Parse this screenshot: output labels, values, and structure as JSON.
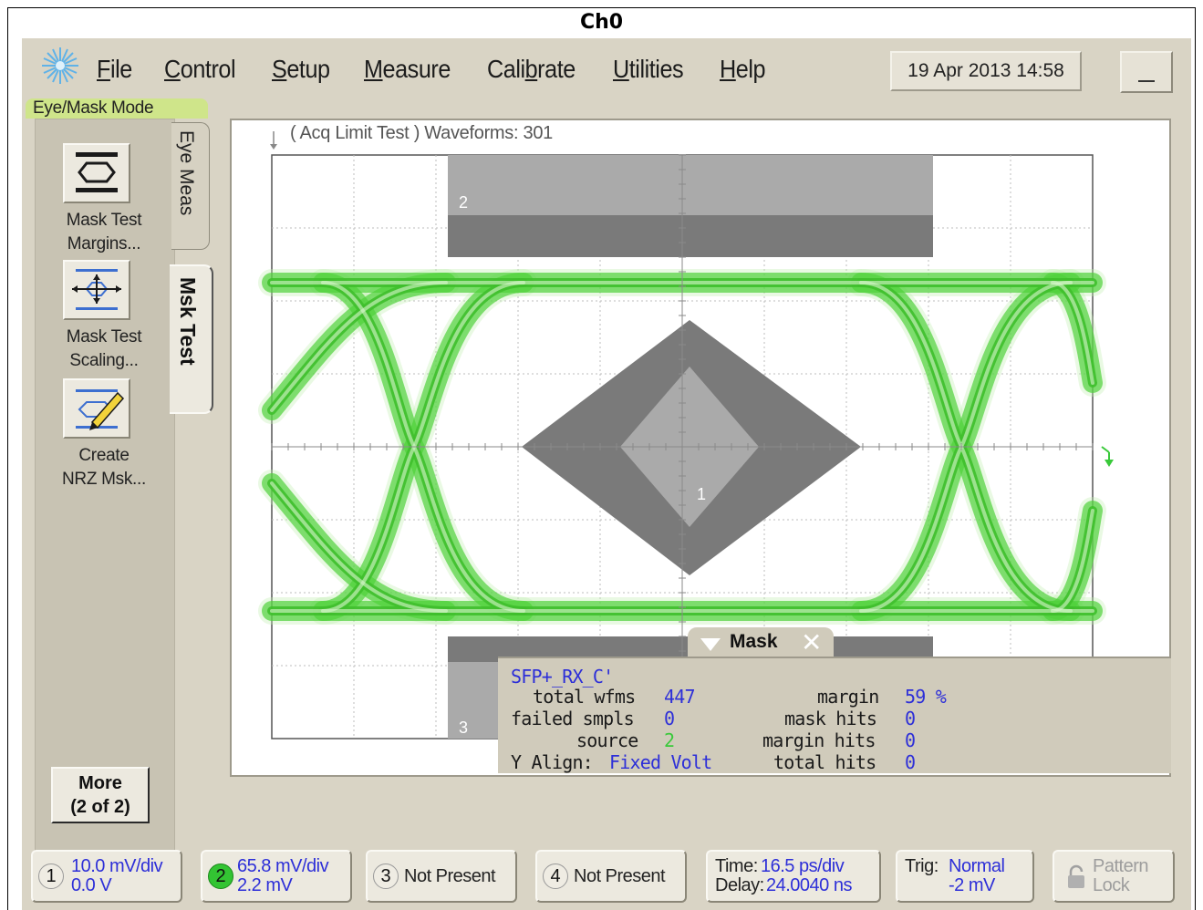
{
  "caption": "Ch0",
  "menu": {
    "items": [
      {
        "pre": "",
        "ul": "F",
        "post": "ile"
      },
      {
        "pre": "",
        "ul": "C",
        "post": "ontrol"
      },
      {
        "pre": "",
        "ul": "S",
        "post": "etup"
      },
      {
        "pre": "",
        "ul": "M",
        "post": "easure"
      },
      {
        "pre": "Cali",
        "ul": "b",
        "post": "rate"
      },
      {
        "pre": "",
        "ul": "U",
        "post": "tilities"
      },
      {
        "pre": "",
        "ul": "H",
        "post": "elp"
      }
    ]
  },
  "date_time": "19 Apr 2013   14:58",
  "mode": "Eye/Mask Mode",
  "left_panel": {
    "tools": [
      {
        "line1": "Mask Test",
        "line2": "Margins...",
        "icon": "mask-margins-icon"
      },
      {
        "line1": "Mask Test",
        "line2": "Scaling...",
        "icon": "mask-scaling-icon"
      },
      {
        "line1": "Create",
        "line2": "NRZ Msk...",
        "icon": "create-mask-icon"
      }
    ],
    "more": {
      "line1": "More",
      "line2": "(2 of 2)"
    },
    "tabs": {
      "eye_meas": "Eye Meas",
      "msk_test": "Msk Test"
    }
  },
  "plot": {
    "acq_label": "( Acq Limit Test )  Waveforms: 301",
    "region_labels": [
      "1",
      "2",
      "3"
    ],
    "trace_color": "#4fd13a",
    "mask_dark": "#7a7a7a",
    "mask_light": "#aaaaaa"
  },
  "mask_panel": {
    "title": "Mask",
    "name": "SFP+_RX_C'",
    "total_wfms_label": "total wfms",
    "total_wfms": "447",
    "failed_smpls_label": "failed smpls",
    "failed_smpls": "0",
    "source_label": "source",
    "source": "2",
    "y_align_label": "Y Align:",
    "y_align": "Fixed Volt",
    "margin_label": "margin",
    "margin": "59 %",
    "mask_hits_label": "mask hits",
    "mask_hits": "0",
    "margin_hits_label": "margin hits",
    "margin_hits": "0",
    "total_hits_label": "total hits",
    "total_hits": "0"
  },
  "bottom_bar": {
    "ch1": {
      "num": "1",
      "scale": "10.0 mV/div",
      "offset": "0.0 V"
    },
    "ch2": {
      "num": "2",
      "scale": "65.8 mV/div",
      "offset": "2.2 mV"
    },
    "ch3": {
      "num": "3",
      "status": "Not Present"
    },
    "ch4": {
      "num": "4",
      "status": "Not Present"
    },
    "time": {
      "time_label": "Time:",
      "time_value": "16.5 ps/div",
      "delay_label": "Delay:",
      "delay_value": "24.0040 ns"
    },
    "trig": {
      "label": "Trig:",
      "mode": "Normal",
      "level": "-2 mV"
    },
    "pattern_lock": {
      "line1": "Pattern",
      "line2": "Lock"
    }
  }
}
